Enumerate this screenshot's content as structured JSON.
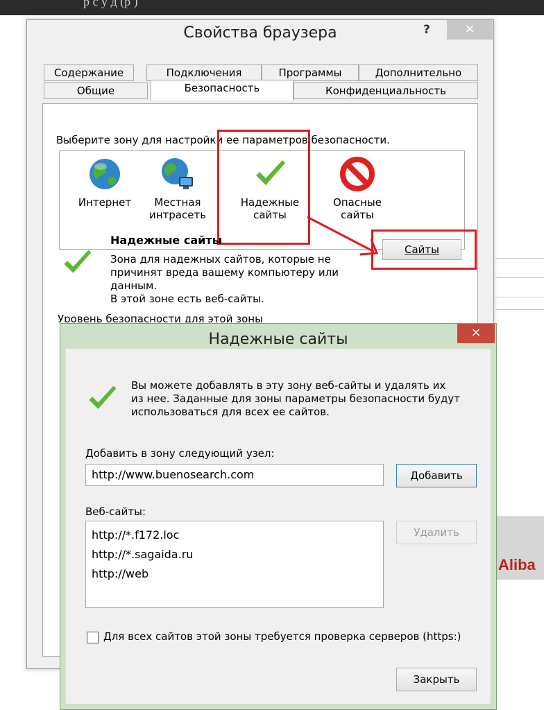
{
  "background": {
    "caption_fragment": "р с у д        (р  )",
    "ad_fragment": "Aliba"
  },
  "main_dialog": {
    "title": "Свойства браузера",
    "help_label": "?",
    "close_label": "×",
    "tabs_row1": [
      "Содержание",
      "Подключения",
      "Программы",
      "Дополнительно"
    ],
    "tabs_row2": [
      "Общие",
      "Безопасность",
      "Конфиденциальность"
    ],
    "active_tab": "Безопасность",
    "zone_prompt": "Выберите зону для настройки ее параметров безопасности.",
    "zones": [
      {
        "line1": "Интернет",
        "line2": "",
        "icon": "globe-icon"
      },
      {
        "line1": "Местная",
        "line2": "интрасеть",
        "icon": "intranet-globe-icon"
      },
      {
        "line1": "Надежные",
        "line2": "сайты",
        "icon": "checkmark-icon"
      },
      {
        "line1": "Опасные",
        "line2": "сайты",
        "icon": "prohibited-icon"
      }
    ],
    "selected_zone_title": "Надежные сайты",
    "selected_zone_desc_1": "Зона для надежных сайтов, которые не",
    "selected_zone_desc_2": "причинят вреда вашему компьютеру или",
    "selected_zone_desc_3": "данным.",
    "selected_zone_desc_4": "В этой зоне есть веб-сайты.",
    "sites_button": "Сайты",
    "security_level_label": "Уровень безопасности для этой зоны"
  },
  "trusted_dialog": {
    "title": "Надежные сайты",
    "close_label": "×",
    "info_1": "Вы можете добавлять в эту зону веб-сайты и удалять их",
    "info_2": "из нее. Заданные для зоны параметры безопасности будут",
    "info_3": "использоваться для всех ее сайтов.",
    "add_label": "Добавить в зону следующий узел:",
    "add_value": "http://www.buenosearch.com",
    "add_button": "Добавить",
    "websites_label": "Веб-сайты:",
    "websites": [
      "http://*.f172.loc",
      "http://*.sagaida.ru",
      "http://web"
    ],
    "remove_button": "Удалить",
    "https_checkbox_label": "Для всех сайтов этой зоны требуется проверка серверов (https:)",
    "https_checked": false,
    "close_button": "Закрыть"
  },
  "colors": {
    "highlight": "#e01b1b",
    "check_green": "#5cb82e",
    "dialog_frame": "#cfe0c8"
  }
}
